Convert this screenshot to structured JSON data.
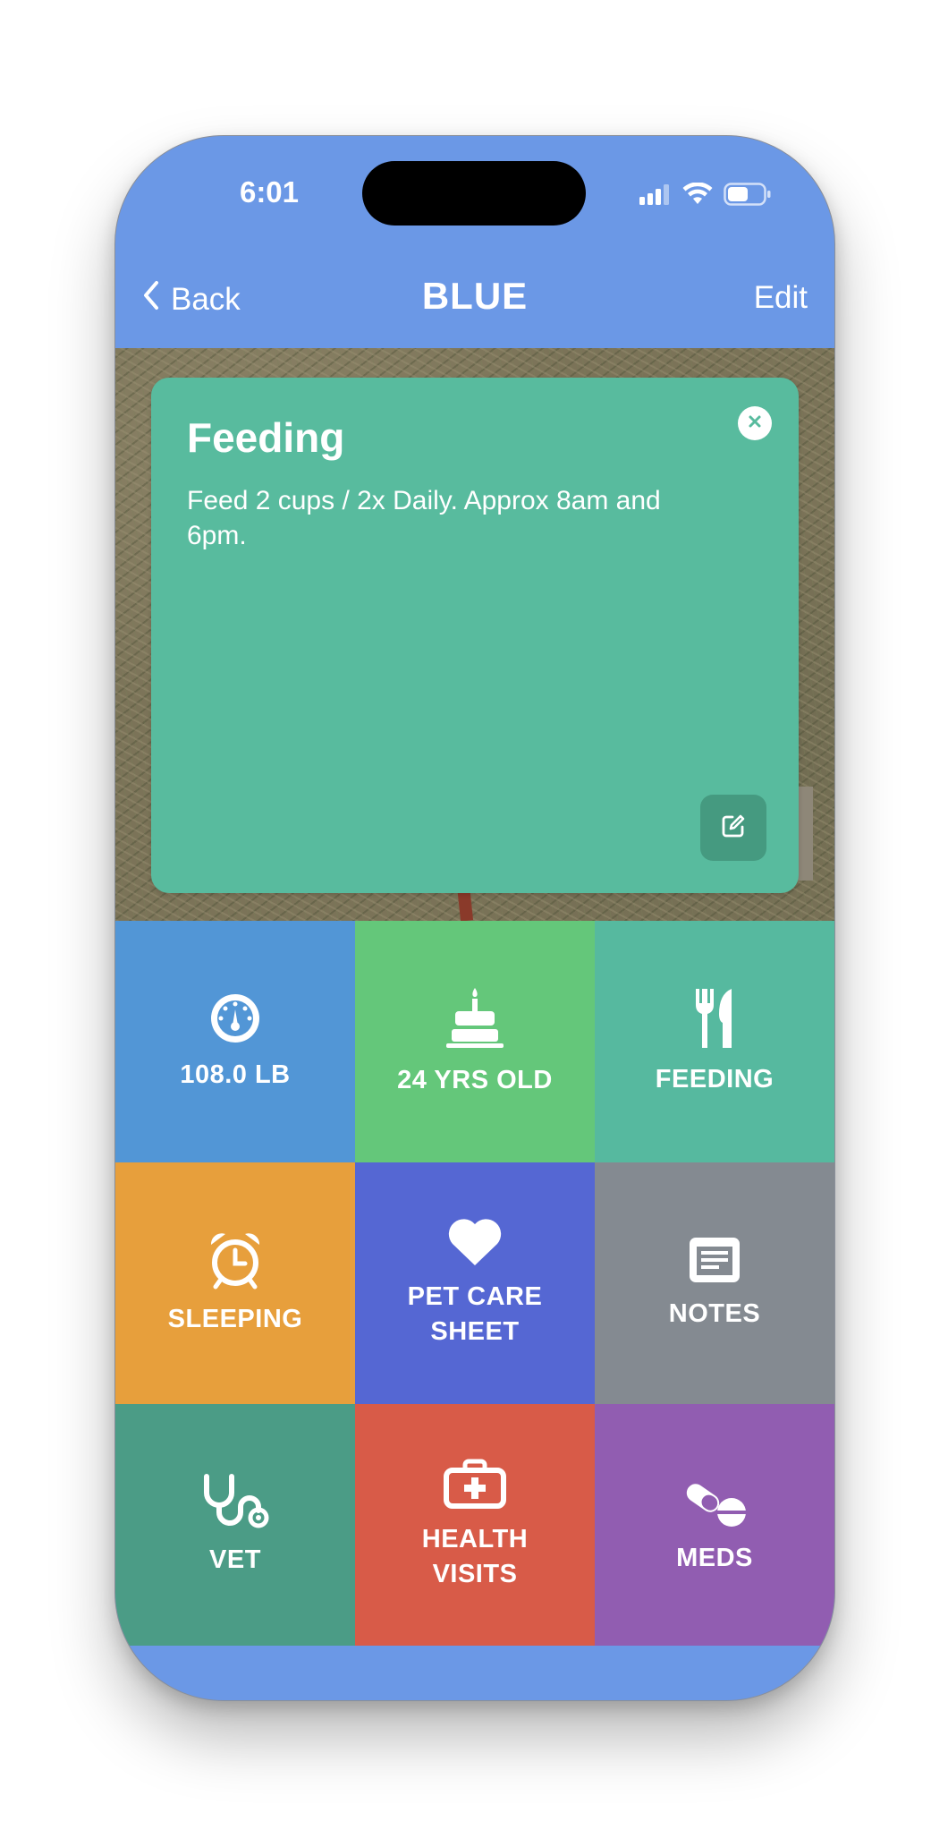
{
  "status_bar": {
    "time": "6:01"
  },
  "nav": {
    "back_label": "Back",
    "title": "BLUE",
    "edit_label": "Edit"
  },
  "card": {
    "title": "Feeding",
    "body": "Feed 2 cups / 2x Daily. Approx 8am and 6pm.",
    "color": "#58bb9e"
  },
  "tiles": [
    {
      "label": "108.0 LB",
      "icon": "gauge-icon",
      "color": "#5296d6"
    },
    {
      "label": "24 YRS OLD",
      "icon": "birthday-cake-icon",
      "color": "#64c77a"
    },
    {
      "label": "FEEDING",
      "icon": "fork-knife-icon",
      "color": "#56b99f"
    },
    {
      "label": "SLEEPING",
      "icon": "alarm-clock-icon",
      "color": "#e79f3c"
    },
    {
      "label": "PET CARE\nSHEET",
      "icon": "heart-icon",
      "color": "#5567d3"
    },
    {
      "label": "NOTES",
      "icon": "notes-icon",
      "color": "#848a91"
    },
    {
      "label": "VET",
      "icon": "stethoscope-icon",
      "color": "#4b9c86"
    },
    {
      "label": "HEALTH\nVISITS",
      "icon": "medical-kit-icon",
      "color": "#d85b48"
    },
    {
      "label": "MEDS",
      "icon": "pills-icon",
      "color": "#915db1"
    }
  ],
  "theme": {
    "header_color": "#6b98e6"
  }
}
